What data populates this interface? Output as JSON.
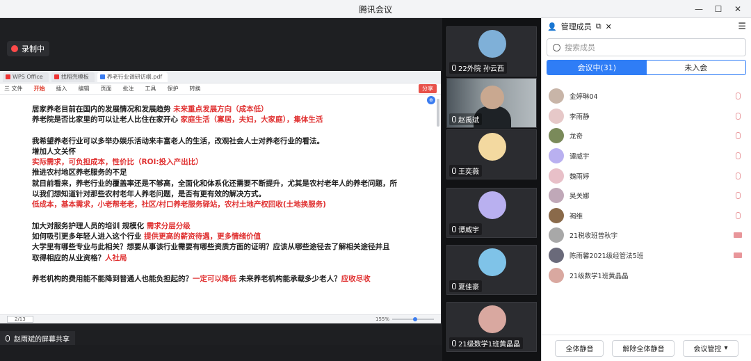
{
  "window": {
    "title": "腾讯会议"
  },
  "recording": {
    "label": "录制中"
  },
  "wps": {
    "tabs": [
      "WPS Office",
      "找稻壳模板",
      "养老行业调研访纲.pdf"
    ],
    "menu": [
      "三 文件",
      "开始",
      "插入",
      "编辑",
      "页面",
      "批注",
      "工具",
      "保护",
      "转换"
    ],
    "share_label": "分享"
  },
  "document": {
    "lines": [
      {
        "black": "居家养老目前在国内的发展情况和发展趋势 ",
        "red": "未来重点发展方向（成本低）"
      },
      {
        "black": "养老院是否比家里的可以让老人比住在家开心 ",
        "red": "家庭生活（寡居，夫妇，大家庭），集体生活"
      },
      {
        "gap": true
      },
      {
        "black": "我希望养老行业可以多举办娱乐活动来丰富老人的生活，改观社会人士对养老行业的看法。",
        "red": ""
      },
      {
        "black": "增加人文关怀",
        "red": ""
      },
      {
        "black": "",
        "red": "实际需求，可负担成本，性价比（ROI:投入产出比）"
      },
      {
        "black": "推进农村地区养老服务的不足",
        "red": ""
      },
      {
        "black": "就目前看来，养老行业的覆盖率还是不够高，全面化和体系化还需要不断提升，尤其是农村老年人的养老问题，所",
        "red": ""
      },
      {
        "black": "以我们想知道针对那些农村老年人养老问题，是否有更有效的解决方式。",
        "red": ""
      },
      {
        "black": "",
        "red": "低成本，基本需求，小老帮老老，社区/村口养老服务驿站，农村土地产权回收(土地换服务)"
      },
      {
        "gap": true
      },
      {
        "black": "加大对服务护理人员的培训  规模化 ",
        "red": "需求分层分级"
      },
      {
        "black": "如何吸引更多年轻人进入这个行业 ",
        "red": "提供更高的薪资待遇，更多情绪价值"
      },
      {
        "black": "大学里有哪些专业与此相关？想要从事该行业需要有哪些资质方面的证明？应该从哪些途径去了解相关途径并且",
        "red": ""
      },
      {
        "black": "取得相应的从业资格？",
        "red": "人社局"
      },
      {
        "gap": true
      },
      {
        "black": "养老机构的费用能不能降到普通人也能负担起的？",
        "red": "一定可以降低",
        "black2": " 未来养老机构能承载多少老人？",
        "red2": "应收尽收"
      }
    ],
    "page_indicator": "2/13",
    "zoom": "155%"
  },
  "screen_share": {
    "label": "赵雨斌的屏幕共享"
  },
  "video_tiles": [
    {
      "name": "22外院 孙云西",
      "color": "#7fb0d8"
    },
    {
      "name": "赵禹斌",
      "color": "#c9a890"
    },
    {
      "name": "王奕薇",
      "color": "#f3d9a0"
    },
    {
      "name": "谭威宇",
      "color": "#b9b0f0"
    },
    {
      "name": "夏佳豪",
      "color": "#7fc3e8"
    },
    {
      "name": "21级数学1班黄晶晶",
      "color": "#d9a8a0"
    }
  ],
  "panel": {
    "title": "管理成员",
    "search_placeholder": "搜索成员",
    "tab_in": "会议中(31)",
    "tab_out": "未入会",
    "members": [
      {
        "name": "金婷琳04",
        "color": "#c8b5a8",
        "media": "mic"
      },
      {
        "name": "李雨静",
        "color": "#e6c8c8",
        "media": "mic"
      },
      {
        "name": "龙奇",
        "color": "#7a8a5a",
        "media": "mic"
      },
      {
        "name": "谭威宇",
        "color": "#b9b0f0",
        "media": "mic"
      },
      {
        "name": "魏雨婷",
        "color": "#e8c0c8",
        "media": "mic"
      },
      {
        "name": "吴关娜",
        "color": "#c0a8b8",
        "media": "mic"
      },
      {
        "name": "褐维",
        "color": "#8a6a4a",
        "media": "mic"
      },
      {
        "name": "21税收班曾秋宇",
        "color": "#a8a8a8",
        "media": "cam"
      },
      {
        "name": "陈雨馨2021级经管法5班",
        "color": "#6a6a7a",
        "media": "cam"
      },
      {
        "name": "21级数学1班黄晶晶",
        "color": "#d9a8a0",
        "media": "none"
      }
    ],
    "btn_mute_all": "全体静音",
    "btn_unmute_all": "解除全体静音",
    "btn_control": "会议管控"
  }
}
